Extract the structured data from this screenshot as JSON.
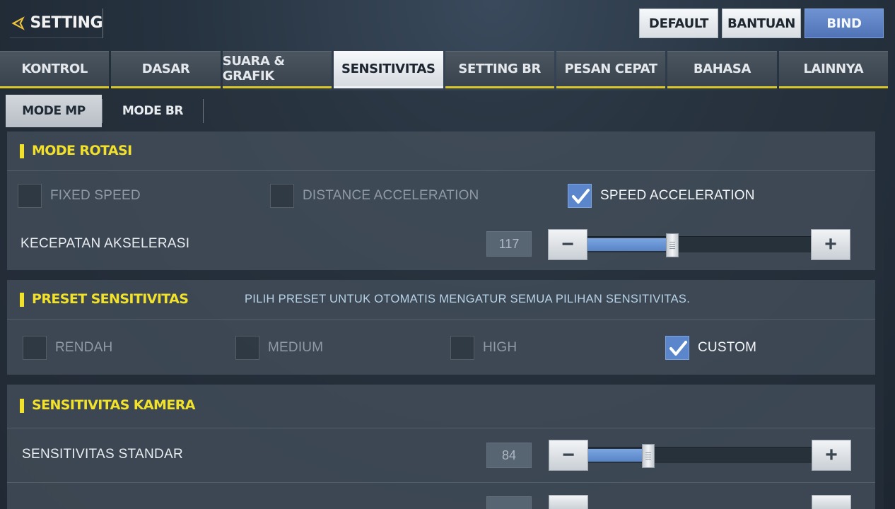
{
  "header": {
    "title": "SETTING",
    "buttons": {
      "default": "DEFAULT",
      "help": "BANTUAN",
      "bind": "BIND"
    }
  },
  "tabs": [
    {
      "label": "KONTROL"
    },
    {
      "label": "DASAR"
    },
    {
      "label": "SUARA & GRAFIK"
    },
    {
      "label": "SENSITIVITAS",
      "active": true
    },
    {
      "label": "SETTING BR"
    },
    {
      "label": "PESAN CEPAT"
    },
    {
      "label": "BAHASA"
    },
    {
      "label": "LAINNYA"
    }
  ],
  "subtabs": [
    {
      "label": "MODE MP",
      "active": true
    },
    {
      "label": "MODE BR"
    }
  ],
  "rotation": {
    "title": "MODE ROTASI",
    "options": [
      {
        "label": "FIXED SPEED",
        "checked": false
      },
      {
        "label": "DISTANCE ACCELERATION",
        "checked": false
      },
      {
        "label": "SPEED ACCELERATION",
        "checked": true
      }
    ],
    "acceleration": {
      "label": "KECEPATAN AKSELERASI",
      "value": "117",
      "fraction": 0.38
    }
  },
  "preset": {
    "title": "PRESET SENSITIVITAS",
    "description": "PILIH PRESET UNTUK OTOMATIS MENGATUR SEMUA PILIHAN SENSITIVITAS.",
    "options": [
      {
        "label": "RENDAH",
        "checked": false
      },
      {
        "label": "MEDIUM",
        "checked": false
      },
      {
        "label": "HIGH",
        "checked": false
      },
      {
        "label": "CUSTOM",
        "checked": true
      }
    ]
  },
  "camera": {
    "title": "SENSITIVITAS KAMERA",
    "standard": {
      "label": "SENSITIVITAS STANDAR",
      "value": "84",
      "fraction": 0.27
    }
  },
  "colors": {
    "accent_yellow": "#f2e12b",
    "bind_blue": "#5b7fc2",
    "check_blue": "#5b86cc"
  }
}
